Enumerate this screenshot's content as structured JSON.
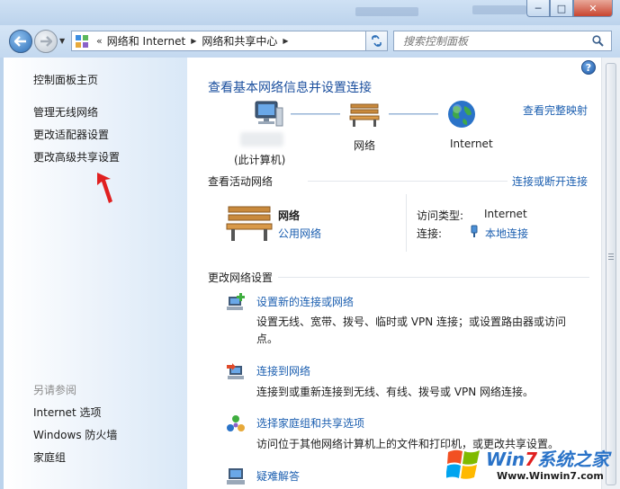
{
  "window": {
    "controls": {
      "minimize": "─",
      "maximize": "□",
      "close": "✕"
    }
  },
  "navbar": {
    "back_icon": "arrow-left-icon",
    "forward_icon": "arrow-right-icon",
    "breadcrumb_overflow": "«",
    "breadcrumb": [
      "网络和 Internet",
      "网络和共享中心"
    ],
    "search_placeholder": "搜索控制面板"
  },
  "sidebar": {
    "home": "控制面板主页",
    "links": [
      "管理无线网络",
      "更改适配器设置",
      "更改高级共享设置"
    ],
    "see_also_title": "另请参阅",
    "see_also": [
      "Internet 选项",
      "Windows 防火墙",
      "家庭组"
    ]
  },
  "main": {
    "title": "查看基本网络信息并设置连接",
    "view_full_map": "查看完整映射",
    "map_nodes": [
      "(此计算机)",
      "网络",
      "Internet"
    ],
    "active_title": "查看活动网络",
    "connect_disconnect": "连接或断开连接",
    "active_network": {
      "name": "网络",
      "type": "公用网络",
      "access_type_label": "访问类型:",
      "access_type_value": "Internet",
      "connection_label": "连接:",
      "connection_value": "本地连接"
    },
    "change_title": "更改网络设置",
    "tasks": [
      {
        "title": "设置新的连接或网络",
        "desc": "设置无线、宽带、拨号、临时或 VPN 连接；或设置路由器或访问",
        "desc2": "点。"
      },
      {
        "title": "连接到网络",
        "desc": "连接到或重新连接到无线、有线、拨号或 VPN 网络连接。"
      },
      {
        "title": "选择家庭组和共享选项",
        "desc": "访问位于其他网络计算机上的文件和打印机，或更改共享设置。"
      },
      {
        "title": "疑难解答"
      }
    ]
  },
  "watermark": {
    "brand_win": "Win",
    "brand_7": "7",
    "brand_rest": "系统之家",
    "url": "Www.Winwin7.com"
  },
  "colors": {
    "link": "#1c5fb0",
    "heading": "#1b4f9e",
    "arrow": "#e02020"
  }
}
